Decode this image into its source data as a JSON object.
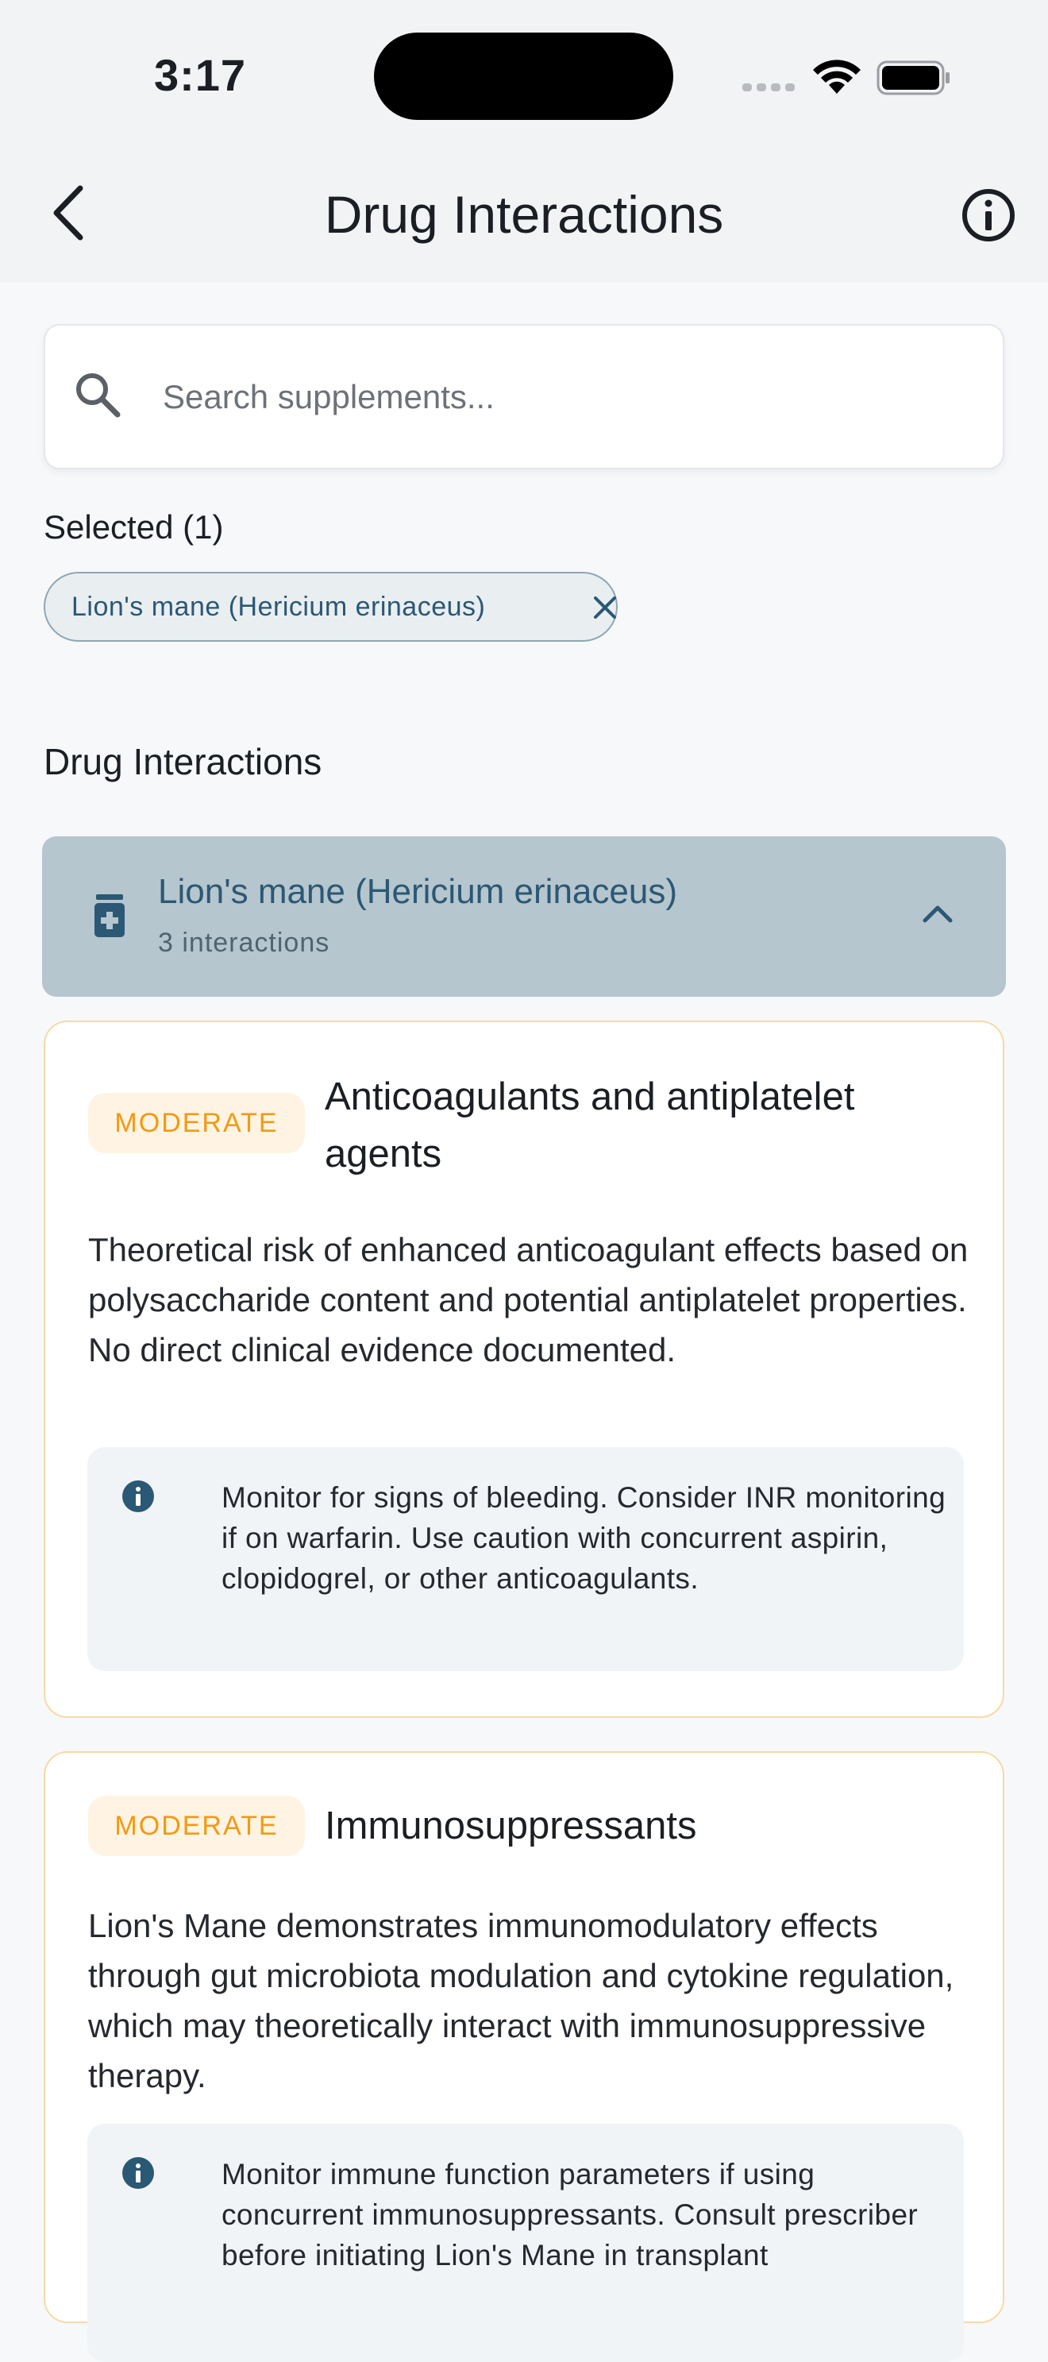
{
  "status_bar": {
    "time": "3:17"
  },
  "navbar": {
    "title": "Drug Interactions",
    "back_icon": "chevron-left-icon",
    "info_icon": "info-circle-icon"
  },
  "search": {
    "placeholder": "Search supplements...",
    "value": "",
    "icon": "search-icon"
  },
  "selected": {
    "label": "Selected (1)",
    "chips": [
      {
        "label": "Lion's mane (Hericium erinaceus)"
      }
    ]
  },
  "interactions_section": {
    "title": "Drug Interactions",
    "groups": [
      {
        "title": "Lion's mane (Hericium erinaceus)",
        "count_label": "3 interactions",
        "icon": "medicine-bottle-icon",
        "expanded": true,
        "items": [
          {
            "severity": "MODERATE",
            "title": "Anticoagulants and antiplatelet agents",
            "description": "Theoretical risk of enhanced anticoagulant effects based on polysaccharide content and potential antiplatelet properties. No direct clinical evidence documented.",
            "recommendation": "Monitor for signs of bleeding. Consider INR monitoring if on warfarin. Use caution with concurrent aspirin, clopidogrel, or other anticoagulants."
          },
          {
            "severity": "MODERATE",
            "title": "Immunosuppressants",
            "description": "Lion's Mane demonstrates immunomodulatory effects through gut microbiota modulation and cytokine regulation, which may theoretically interact with immunosuppressive therapy.",
            "recommendation": "Monitor immune function parameters if using concurrent immunosuppressants. Consult prescriber before initiating Lion's Mane in transplant"
          }
        ]
      }
    ]
  },
  "colors": {
    "accent": "#2b5874",
    "moderate": "#f29a12",
    "moderate_bg": "#fff4e3",
    "group_header_bg": "#b6c6ce",
    "card_border": "#f8d9a6"
  }
}
